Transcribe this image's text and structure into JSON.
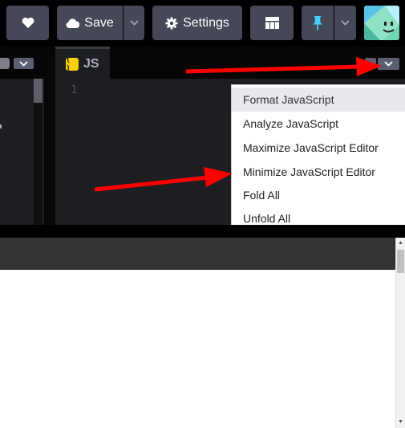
{
  "toolbar": {
    "save_label": "Save",
    "settings_label": "Settings"
  },
  "js_editor": {
    "tab_badge": "( )",
    "tab_title": "JS",
    "line_number": "1"
  },
  "menu": {
    "items": [
      {
        "label": "Format JavaScript",
        "active": true
      },
      {
        "label": "Analyze JavaScript"
      },
      {
        "label": "Maximize JavaScript Editor"
      },
      {
        "label": "Minimize JavaScript Editor"
      },
      {
        "label": "Fold All"
      },
      {
        "label": "Unfold All"
      }
    ]
  },
  "icons": {
    "heart": "heart-icon",
    "cloud": "cloud-icon",
    "gear": "gear-icon",
    "layout": "layout-icon",
    "pin": "pin-icon",
    "chevron": "chevron-down-icon",
    "avatar": "user-avatar"
  },
  "colors": {
    "button_bg": "#444857",
    "editor_bg": "#1d1e22",
    "js_badge": "#fcd000",
    "pin_blue": "#47cfff",
    "arrow_red": "#ff0000"
  }
}
